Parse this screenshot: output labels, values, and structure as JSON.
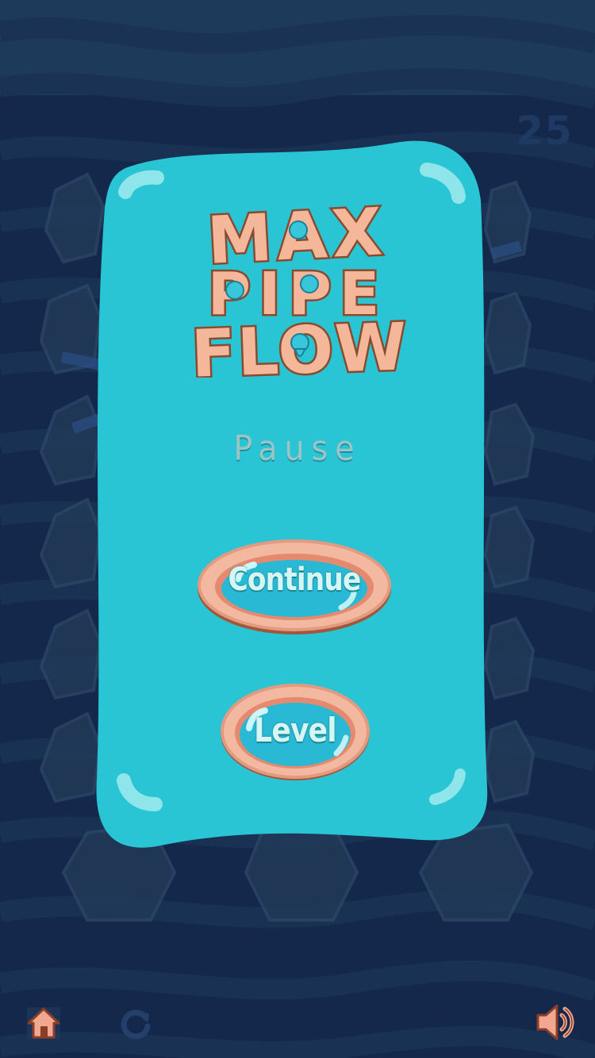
{
  "game": {
    "title": "MAX PIPE FLOW",
    "level_number": "25"
  },
  "pause_dialog": {
    "title": "Pause",
    "continue_label": "Continue",
    "level_label": "Level"
  },
  "bottom_bar": {
    "home_icon": "home-icon",
    "restart_icon": "restart-icon",
    "sound_icon": "sound-on-icon"
  },
  "colors": {
    "background": "#13284a",
    "panel": "#29c5d4",
    "button_rim": "#f2b8a0",
    "button_inner": "#2ab9d4",
    "icon": "#f0a891"
  }
}
